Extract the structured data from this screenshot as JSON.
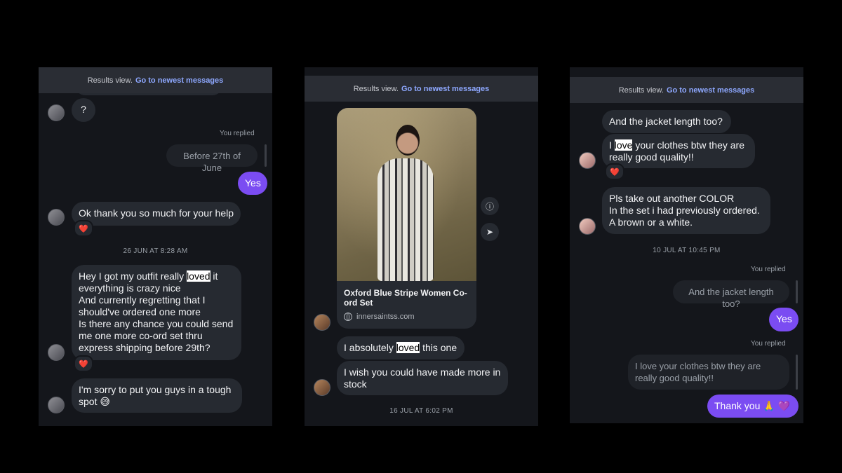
{
  "banner": {
    "text": "Results view.",
    "link": "Go to newest messages"
  },
  "panel1": {
    "question": "?",
    "you_replied": "You replied",
    "quoted": "Before 27th of June",
    "yes": "Yes",
    "thanks": "Ok thank you so much for your help",
    "reaction": "❤️",
    "timestamp": "26 JUN AT 8:28 AM",
    "msg_a1": "Hey I got my outfit really ",
    "msg_hl": "loved",
    "msg_a2": " it\neverything is crazy nice\nAnd currently regretting that I should've ordered one more\nIs there any chance you could send me one more co-ord set thru express shipping before 29th?",
    "reaction2": "❤️",
    "sorry": "I'm sorry to put you guys in a tough spot 😅"
  },
  "panel2": {
    "top_cut_1": "",
    "product_title": "Oxford Blue Stripe Women Co-ord Set",
    "product_url": "innersaintss.com",
    "info_icon": "info-icon",
    "share_icon": "share-icon",
    "msg1_a": "I absolutely ",
    "msg1_hl": "loved",
    "msg1_b": " this one",
    "msg2": "I wish you could have made more in stock",
    "timestamp": "16 JUL AT 6:02 PM"
  },
  "panel3": {
    "top_cut": "",
    "q_jacket": "And the jacket length too?",
    "love_a": "I ",
    "love_hl": "love",
    "love_b": " your clothes btw they are really good quality!!",
    "reaction": "❤️",
    "color_msg": "Pls take out another COLOR\nIn the set i had previously ordered.\nA brown or a white.",
    "timestamp": "10 JUL AT 10:45 PM",
    "you_replied_1": "You replied",
    "quoted_1": "And the jacket length too?",
    "yes": "Yes",
    "you_replied_2": "You replied",
    "quoted_2": "I love your clothes btw they are really good quality!!",
    "thank_you": "Thank you 🙏 💜"
  },
  "colors": {
    "accent": "#7b4cf2",
    "link": "#8ea8ff",
    "bubble": "#262a31",
    "panel": "#14161b"
  }
}
